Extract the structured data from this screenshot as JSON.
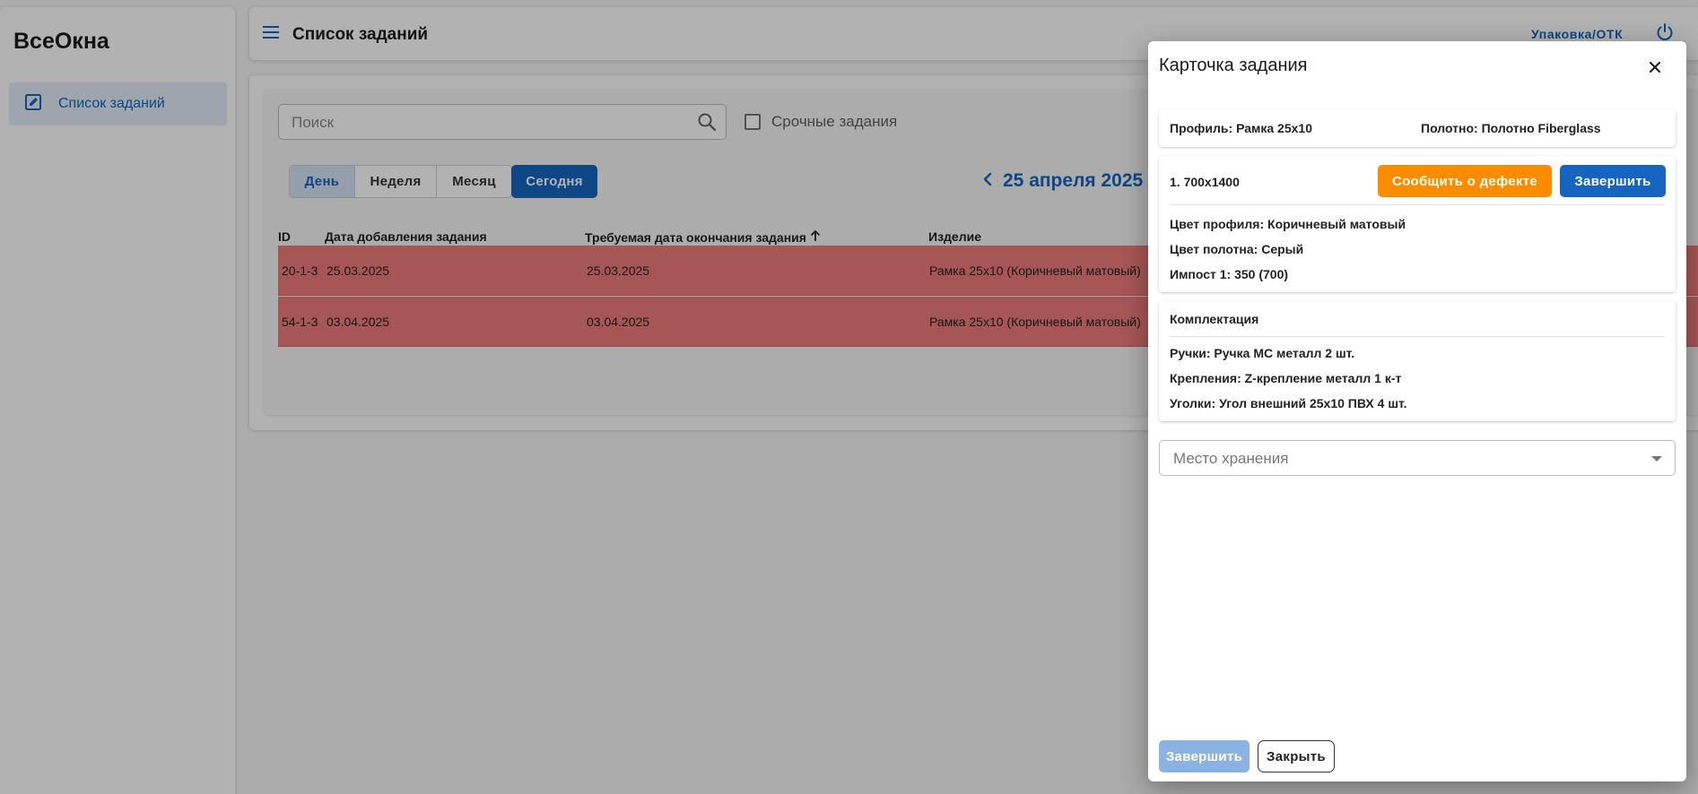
{
  "app": {
    "brand": "ВсеОкна"
  },
  "sidebar": {
    "items": [
      {
        "label": "Список заданий",
        "icon": "edit-square-icon"
      }
    ]
  },
  "topbar": {
    "title": "Список заданий",
    "role": "Упаковка/ОТК"
  },
  "filters": {
    "search_placeholder": "Поиск",
    "urgent_label": "Срочные задания"
  },
  "period": {
    "day": "День",
    "week": "Неделя",
    "month": "Месяц",
    "active": "День"
  },
  "today_label": "Сегодня",
  "current_date": "25 апреля 2025",
  "table": {
    "columns": [
      "ID",
      "Дата добавления задания",
      "Требуемая дата окончания задания",
      "Изделие"
    ],
    "sorted_column": "Требуемая дата окончания задания",
    "rows": [
      {
        "id": "20-1-3",
        "added": "25.03.2025",
        "due": "25.03.2025",
        "product": "Рамка 25x10 (Коричневый матовый)"
      },
      {
        "id": "54-1-3",
        "added": "03.04.2025",
        "due": "03.04.2025",
        "product": "Рамка 25x10 (Коричневый матовый)"
      }
    ],
    "row_color": "#ef7c7c"
  },
  "dialog": {
    "title": "Карточка задания",
    "profile": "Профиль: Рамка 25x10",
    "mesh": "Полотно: Полотно Fiberglass",
    "item": {
      "name": "1. 700x1400",
      "report_defect": "Сообщить о дефекте",
      "finish": "Завершить",
      "profile_color": "Цвет профиля: Коричневый матовый",
      "mesh_color": "Цвет полотна: Серый",
      "impost": "Импост 1: 350 (700)"
    },
    "kit": {
      "title": "Комплектация",
      "handles": "Ручки: Ручка МС металл 2 шт.",
      "mounts": "Крепления: Z-крепление металл 1 к-т",
      "corners": "Уголки: Угол внешний 25x10 ПВХ 4 шт."
    },
    "storage_placeholder": "Место хранения",
    "footer": {
      "finish": "Завершить",
      "close": "Закрыть"
    }
  },
  "colors": {
    "primary": "#1565c0",
    "warning": "#fb8c00",
    "danger_row": "#ef7c7c"
  }
}
